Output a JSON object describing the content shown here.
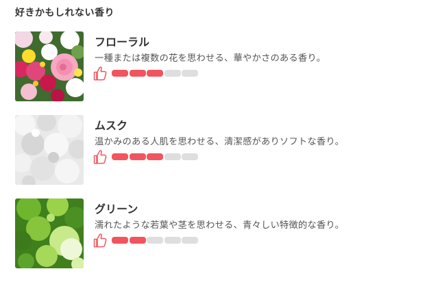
{
  "section": {
    "title": "好きかもしれない香り"
  },
  "accent_color": "#f2545f",
  "inactive_color": "#dedede",
  "items": [
    {
      "name": "フローラル",
      "description": "一種または複数の花を思わせる、華やかさのある香り。",
      "image": "floral-flowers-photo",
      "icon": "thumbs-up-icon",
      "rating": 3,
      "rating_max": 5
    },
    {
      "name": "ムスク",
      "description": "温かみのある人肌を思わせる、清潔感がありソフトな香り。",
      "image": "white-fluffy-texture-photo",
      "icon": "thumbs-up-icon",
      "rating": 3,
      "rating_max": 5
    },
    {
      "name": "グリーン",
      "description": "濡れたような若葉や茎を思わせる、青々しい特徴的な香り。",
      "image": "green-leaves-photo",
      "icon": "thumbs-up-icon",
      "rating": 2,
      "rating_max": 5
    }
  ]
}
